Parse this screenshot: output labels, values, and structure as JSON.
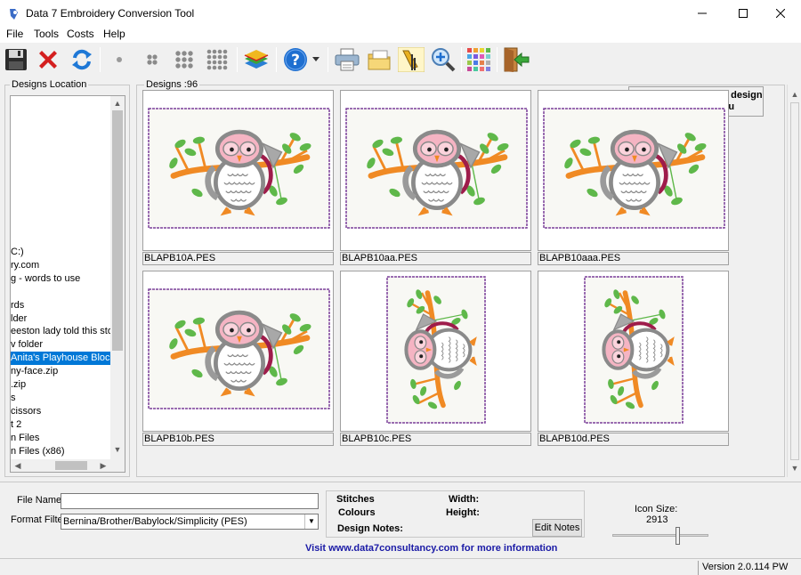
{
  "window": {
    "title": "Data 7 Embroidery Conversion Tool"
  },
  "menu": [
    "File",
    "Tools",
    "Costs",
    "Help"
  ],
  "toolbar": {
    "hint": "Right click mouse on design to activate Menu",
    "icons": [
      "save-icon",
      "delete-icon",
      "refresh-icon",
      "small-dot-icon",
      "grid-2x2-icon",
      "grid-3x3-icon",
      "grid-4x4-icon",
      "layers-icon",
      "help-icon",
      "printer-icon",
      "export-icon",
      "measure-icon",
      "zoom-icon",
      "color-grid-icon",
      "exit-icon"
    ]
  },
  "designs_location": {
    "label": "Designs Location",
    "items": [
      {
        "text": "C:)",
        "selected": false
      },
      {
        "text": "ry.com",
        "selected": false
      },
      {
        "text": "g - words to use",
        "selected": false
      },
      {
        "text": "",
        "selected": false
      },
      {
        "text": "rds",
        "selected": false
      },
      {
        "text": "lder",
        "selected": false
      },
      {
        "text": "eeston lady told this stor",
        "selected": false
      },
      {
        "text": "v folder",
        "selected": false
      },
      {
        "text": " Anita's Playhouse Block",
        "selected": true
      },
      {
        "text": "ny-face.zip",
        "selected": false
      },
      {
        "text": ".zip",
        "selected": false
      },
      {
        "text": "s",
        "selected": false
      },
      {
        "text": "cissors",
        "selected": false
      },
      {
        "text": "t 2",
        "selected": false
      },
      {
        "text": "n Files",
        "selected": false
      },
      {
        "text": "n Files (x86)",
        "selected": false
      }
    ]
  },
  "designs": {
    "label": "Designs :96",
    "cards": [
      {
        "name": "BLAPB10A.PES",
        "orientation": "landscape"
      },
      {
        "name": "BLAPB10aa.PES",
        "orientation": "landscape"
      },
      {
        "name": "BLAPB10aaa.PES",
        "orientation": "landscape"
      },
      {
        "name": "BLAPB10b.PES",
        "orientation": "landscape"
      },
      {
        "name": "BLAPB10c.PES",
        "orientation": "portrait"
      },
      {
        "name": "BLAPB10d.PES",
        "orientation": "portrait"
      }
    ]
  },
  "bottom": {
    "file_name_label": "File Name",
    "file_name_value": "",
    "format_filter_label": "Format Filter",
    "format_filter_value": "Bernina/Brother/Babylock/Simplicity (PES)",
    "stitches_label": "Stitches",
    "colours_label": "Colours",
    "width_label": "Width:",
    "height_label": "Height:",
    "design_notes_label": "Design Notes:",
    "edit_notes_button": "Edit Notes",
    "icon_size_label": "Icon Size:",
    "icon_size_value": "2913",
    "visit_text": "Visit www.data7consultancy.com for more information"
  },
  "status": {
    "version": "Version 2.0.114 PW"
  },
  "colors": {
    "selection": "#0078d7",
    "visit_link": "#1a1aa6",
    "design_border": "#7a3f9a",
    "owl_orange": "#f08a24",
    "owl_pink": "#f5b4c3",
    "leaf_green": "#5fb84a",
    "owl_gray": "#8a8a8a",
    "wing_crimson": "#9e1c4a"
  }
}
